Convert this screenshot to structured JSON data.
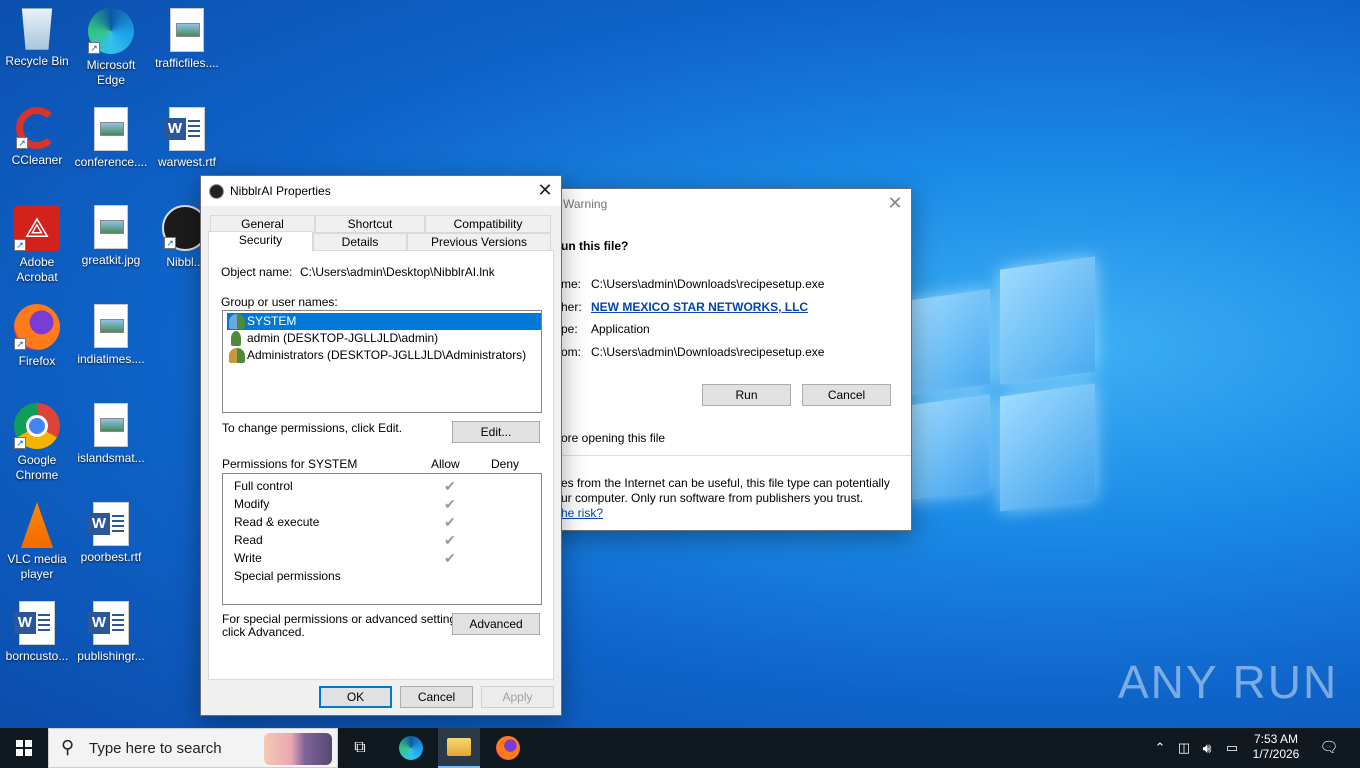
{
  "desktop": {
    "icons": [
      {
        "label": "Recycle Bin"
      },
      {
        "label": "Microsoft Edge"
      },
      {
        "label": "trafficfiles...."
      },
      {
        "label": "CCleaner"
      },
      {
        "label": "conference...."
      },
      {
        "label": "warwest.rtf"
      },
      {
        "label": "Adobe Acrobat"
      },
      {
        "label": "greatkit.jpg"
      },
      {
        "label": "Nibbl..."
      },
      {
        "label": "Firefox"
      },
      {
        "label": "indiatimes...."
      },
      {
        "label": "Google Chrome"
      },
      {
        "label": "islandsmat..."
      },
      {
        "label": "VLC media player"
      },
      {
        "label": "poorbest.rtf"
      },
      {
        "label": "borncusto..."
      },
      {
        "label": "publishingr..."
      }
    ]
  },
  "security_warning": {
    "title": "Warning",
    "question": "un this file?",
    "name_label": "me:",
    "name_value": "C:\\Users\\admin\\Downloads\\recipesetup.exe",
    "publisher_label": "her:",
    "publisher_value": "NEW MEXICO STAR NETWORKS, LLC",
    "type_label": "pe:",
    "type_value": "Application",
    "from_label": "om:",
    "from_value": "C:\\Users\\admin\\Downloads\\recipesetup.exe",
    "run_button": "Run",
    "cancel_button": "Cancel",
    "checkbox_text": "ore opening this file",
    "info_line1": "es from the Internet can be useful, this file type can potentially",
    "info_line2": "ur computer. Only run software from publishers you trust.",
    "risk_link": "he risk?"
  },
  "properties": {
    "title": "NibblrAI Properties",
    "tabs_row1": [
      "General",
      "Shortcut",
      "Compatibility"
    ],
    "tabs_row2": [
      "Security",
      "Details",
      "Previous Versions"
    ],
    "object_name_label": "Object name:",
    "object_name_value": "C:\\Users\\admin\\Desktop\\NibblrAI.lnk",
    "group_label": "Group or user names:",
    "users": [
      "SYSTEM",
      "admin (DESKTOP-JGLLJLD\\admin)",
      "Administrators (DESKTOP-JGLLJLD\\Administrators)"
    ],
    "change_perm_text": "To change permissions, click Edit.",
    "edit_button": "Edit...",
    "permissions_for": "Permissions for SYSTEM",
    "allow_header": "Allow",
    "deny_header": "Deny",
    "permissions": [
      {
        "name": "Full control",
        "allow": true
      },
      {
        "name": "Modify",
        "allow": true
      },
      {
        "name": "Read & execute",
        "allow": true
      },
      {
        "name": "Read",
        "allow": true
      },
      {
        "name": "Write",
        "allow": true
      },
      {
        "name": "Special permissions",
        "allow": false
      }
    ],
    "advanced_text_line1": "For special permissions or advanced settings,",
    "advanced_text_line2": "click Advanced.",
    "advanced_button": "Advanced",
    "ok_button": "OK",
    "cancel_button": "Cancel",
    "apply_button": "Apply"
  },
  "taskbar": {
    "search_placeholder": "Type here to search",
    "time": "7:53 AM",
    "date": "1/7/2026"
  },
  "watermark": "ANY RUN"
}
